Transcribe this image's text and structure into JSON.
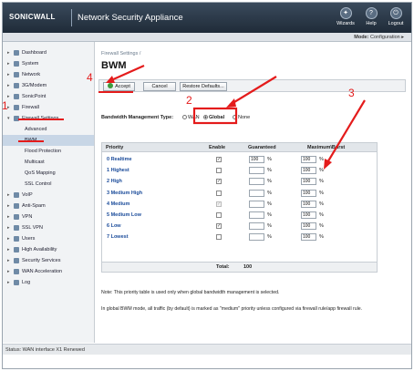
{
  "header": {
    "logo": "SONICWALL",
    "title": "Network Security Appliance",
    "buttons": [
      {
        "label": "Wizards",
        "icon": "wizard-icon",
        "glyph": "✦"
      },
      {
        "label": "Help",
        "icon": "help-icon",
        "glyph": "?"
      },
      {
        "label": "Logout",
        "icon": "logout-icon",
        "glyph": "⏻"
      }
    ]
  },
  "mode": {
    "label": "Mode:",
    "value": "Configuration ▸"
  },
  "sidebar": {
    "items": [
      {
        "label": "Dashboard",
        "arrow": "▸"
      },
      {
        "label": "System",
        "arrow": "▸"
      },
      {
        "label": "Network",
        "arrow": "▸"
      },
      {
        "label": "3G/Modem",
        "arrow": "▸"
      },
      {
        "label": "SonicPoint",
        "arrow": "▸"
      },
      {
        "label": "Firewall",
        "arrow": "▸"
      },
      {
        "label": "Firewall Settings",
        "arrow": "▾"
      },
      {
        "label": "Advanced",
        "arrow": ""
      },
      {
        "label": "BWM",
        "arrow": ""
      },
      {
        "label": "Flood Protection",
        "arrow": ""
      },
      {
        "label": "Multicast",
        "arrow": ""
      },
      {
        "label": "QoS Mapping",
        "arrow": ""
      },
      {
        "label": "SSL Control",
        "arrow": ""
      },
      {
        "label": "VoIP",
        "arrow": "▸"
      },
      {
        "label": "Anti-Spam",
        "arrow": "▸"
      },
      {
        "label": "VPN",
        "arrow": "▸"
      },
      {
        "label": "SSL VPN",
        "arrow": "▸"
      },
      {
        "label": "Users",
        "arrow": "▸"
      },
      {
        "label": "High Availability",
        "arrow": "▸"
      },
      {
        "label": "Security Services",
        "arrow": "▸"
      },
      {
        "label": "WAN Acceleration",
        "arrow": "▸"
      },
      {
        "label": "Log",
        "arrow": "▸"
      }
    ]
  },
  "main": {
    "breadcrumb": "Firewall Settings /",
    "title": "BWM",
    "buttons": {
      "accept": "Accept",
      "cancel": "Cancel",
      "restore": "Restore Defaults..."
    },
    "bwm_type": {
      "label": "Bandwidth Management Type:",
      "options": [
        "WAN",
        "Global",
        "None"
      ],
      "selected": "Global"
    },
    "table": {
      "headers": {
        "priority": "Priority",
        "enable": "Enable",
        "guaranteed": "Guaranteed",
        "burst": "Maximum\\Burst"
      },
      "rows": [
        {
          "priority": "0  Realtime",
          "enabled": true,
          "disabled": false,
          "guaranteed": "100",
          "burst": "100"
        },
        {
          "priority": "1  Highest",
          "enabled": false,
          "disabled": false,
          "guaranteed": "",
          "burst": "100"
        },
        {
          "priority": "2  High",
          "enabled": true,
          "disabled": false,
          "guaranteed": "",
          "burst": "100"
        },
        {
          "priority": "3  Medium High",
          "enabled": false,
          "disabled": false,
          "guaranteed": "",
          "burst": "100"
        },
        {
          "priority": "4  Medium",
          "enabled": true,
          "disabled": true,
          "guaranteed": "",
          "burst": "100"
        },
        {
          "priority": "5  Medium Low",
          "enabled": false,
          "disabled": false,
          "guaranteed": "",
          "burst": "100"
        },
        {
          "priority": "6  Low",
          "enabled": true,
          "disabled": false,
          "guaranteed": "",
          "burst": "100"
        },
        {
          "priority": "7  Lowest",
          "enabled": false,
          "disabled": false,
          "guaranteed": "",
          "burst": "100"
        }
      ],
      "pct": "%",
      "total_label": "Total:",
      "total_value": "100"
    },
    "notes": [
      "Note: This priority table is used only when global bandwidth management is selected.",
      "In global BWM mode, all traffic (by default) is marked as \"medium\" priority unless configured via firewall rule/app firewall rule."
    ]
  },
  "status": "Status: WAN interface X1 Renewed",
  "annotations": [
    "1",
    "2",
    "3",
    "4"
  ],
  "colors": {
    "annotation": "#e41b1b",
    "header": "#1f2b38",
    "selected_nav": "#c8d6e6"
  }
}
